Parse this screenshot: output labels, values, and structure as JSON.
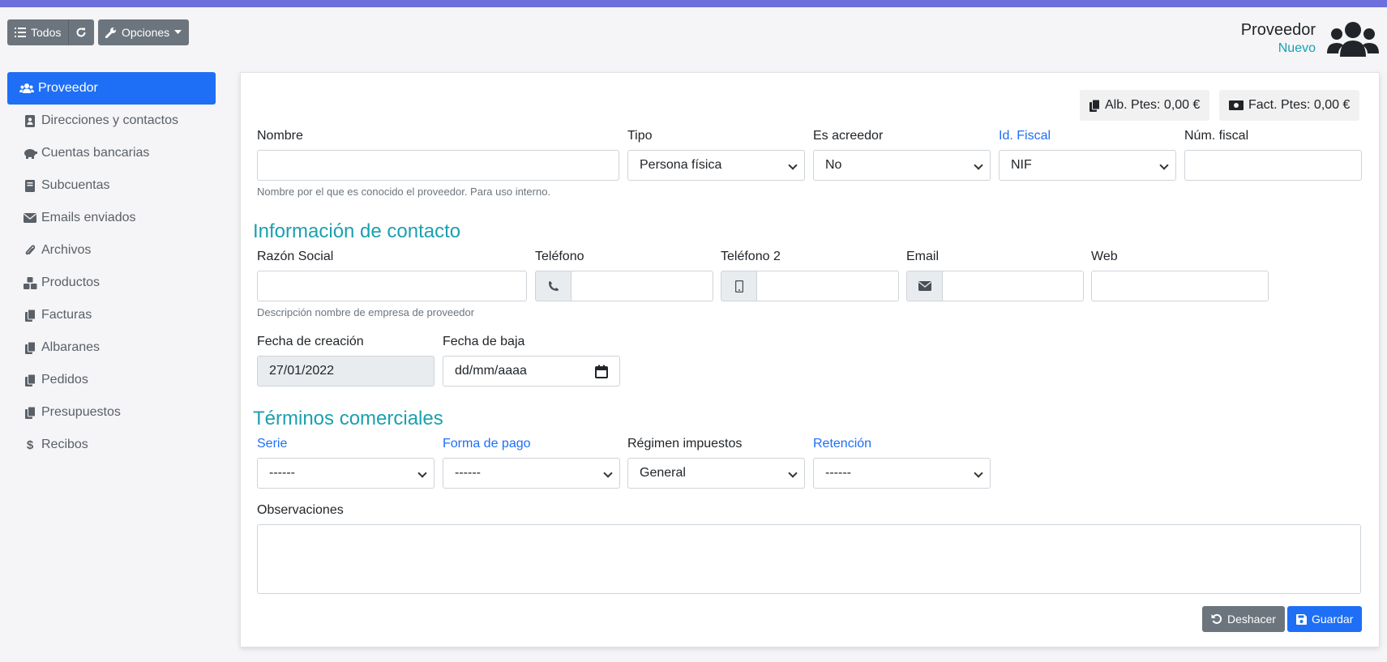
{
  "toolbar": {
    "todos_label": "Todos",
    "opciones_label": "Opciones"
  },
  "header": {
    "title": "Proveedor",
    "subtitle": "Nuevo"
  },
  "sidebar": {
    "items": [
      {
        "label": "Proveedor",
        "icon": "users-icon"
      },
      {
        "label": "Direcciones y contactos",
        "icon": "address-book-icon"
      },
      {
        "label": "Cuentas bancarias",
        "icon": "piggy-bank-icon"
      },
      {
        "label": "Subcuentas",
        "icon": "book-icon"
      },
      {
        "label": "Emails enviados",
        "icon": "envelope-icon"
      },
      {
        "label": "Archivos",
        "icon": "paperclip-icon"
      },
      {
        "label": "Productos",
        "icon": "cubes-icon"
      },
      {
        "label": "Facturas",
        "icon": "copy-icon"
      },
      {
        "label": "Albaranes",
        "icon": "copy-icon"
      },
      {
        "label": "Pedidos",
        "icon": "copy-icon"
      },
      {
        "label": "Presupuestos",
        "icon": "copy-icon"
      },
      {
        "label": "Recibos",
        "icon": "dollar-icon"
      }
    ]
  },
  "badges": {
    "albaranes": "Alb. Ptes: 0,00 €",
    "facturas": "Fact. Ptes: 0,00 €"
  },
  "form": {
    "nombre_label": "Nombre",
    "nombre_help": "Nombre por el que es conocido el proveedor. Para uso interno.",
    "tipo_label": "Tipo",
    "tipo_value": "Persona física",
    "acreedor_label": "Es acreedor",
    "acreedor_value": "No",
    "idfiscal_label": "Id. Fiscal",
    "idfiscal_value": "NIF",
    "numfiscal_label": "Núm. fiscal"
  },
  "contact": {
    "section_title": "Información de contacto",
    "razon_label": "Razón Social",
    "razon_help": "Descripción nombre de empresa de proveedor",
    "telefono_label": "Teléfono",
    "telefono2_label": "Teléfono 2",
    "email_label": "Email",
    "web_label": "Web",
    "fecha_creacion_label": "Fecha de creación",
    "fecha_creacion_value": "27/01/2022",
    "fecha_baja_label": "Fecha de baja",
    "fecha_baja_value": "dd/mm/aaaa"
  },
  "terms": {
    "section_title": "Términos comerciales",
    "serie_label": "Serie",
    "serie_value": "------",
    "pago_label": "Forma de pago",
    "pago_value": "------",
    "regimen_label": "Régimen impuestos",
    "regimen_value": "General",
    "retencion_label": "Retención",
    "retencion_value": "------",
    "observaciones_label": "Observaciones"
  },
  "actions": {
    "undo_label": "Deshacer",
    "save_label": "Guardar"
  }
}
